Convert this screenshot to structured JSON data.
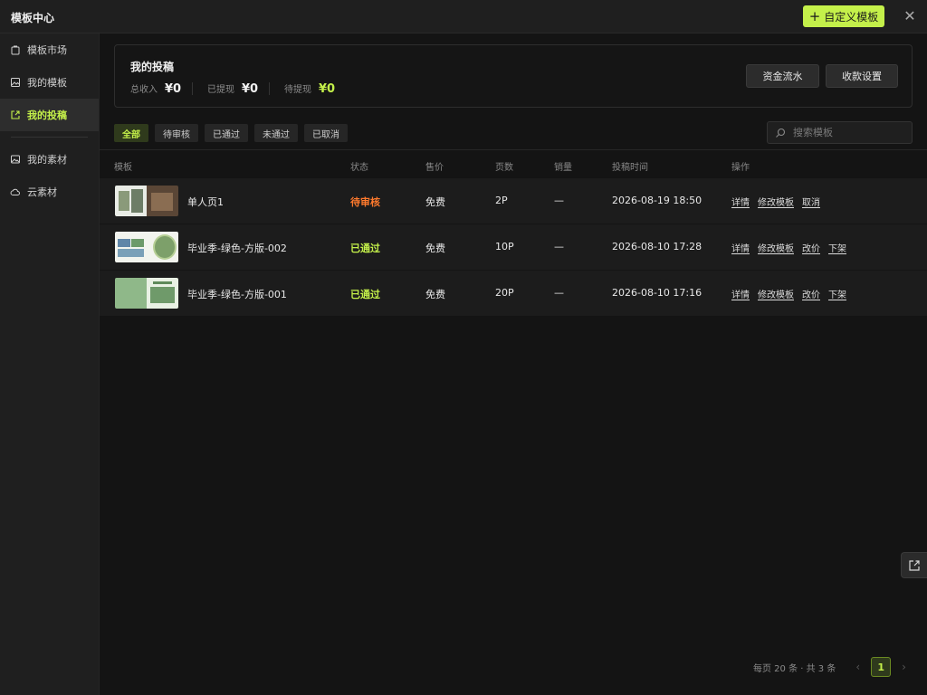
{
  "app": {
    "title": "模板中心",
    "custom_button": "自定义模板"
  },
  "sidebar": {
    "items": [
      {
        "label": "模板市场",
        "icon": "bag-icon",
        "active": false
      },
      {
        "label": "我的模板",
        "icon": "image-book-icon",
        "active": false
      },
      {
        "label": "我的投稿",
        "icon": "share-export-icon",
        "active": true
      },
      {
        "label": "我的素材",
        "icon": "picture-icon",
        "active": false
      },
      {
        "label": "云素材",
        "icon": "cloud-icon",
        "active": false
      }
    ]
  },
  "summary": {
    "title": "我的投稿",
    "total_income_label": "总收入",
    "total_income_value": "¥0",
    "withdrawn_label": "已提现",
    "withdrawn_value": "¥0",
    "pending_label": "待提现",
    "pending_value": "¥0",
    "cashflow_button": "资金流水",
    "payment_settings_button": "收款设置"
  },
  "filters": [
    "全部",
    "待审核",
    "已通过",
    "未通过",
    "已取消"
  ],
  "search": {
    "placeholder": "搜索模板"
  },
  "table": {
    "headers": [
      "模板",
      "状态",
      "售价",
      "页数",
      "销量",
      "投稿时间",
      "操作"
    ],
    "rows": [
      {
        "name": "单人页1",
        "status": "待审核",
        "price": "免费",
        "pages": "2P",
        "sales": "—",
        "time": "2026-08-19 18:50",
        "ops": [
          "详情",
          "修改模板",
          "取消"
        ]
      },
      {
        "name": "毕业季-绿色-方版-002",
        "status": "已通过",
        "price": "免费",
        "pages": "10P",
        "sales": "—",
        "time": "2026-08-10 17:28",
        "ops": [
          "详情",
          "修改模板",
          "改价",
          "下架"
        ]
      },
      {
        "name": "毕业季-绿色-方版-001",
        "status": "已通过",
        "price": "免费",
        "pages": "20P",
        "sales": "—",
        "time": "2026-08-10 17:16",
        "ops": [
          "详情",
          "修改模板",
          "改价",
          "下架"
        ]
      }
    ]
  },
  "pagination": {
    "info": "每页 20 条 · 共 3 条",
    "current_page": "1",
    "prev": "‹",
    "next": "›"
  },
  "colors": {
    "accent": "#c4f04a",
    "pending": "#ff7a2d",
    "background": "#141414",
    "sidebar": "#1f1f1f"
  },
  "window": {
    "close": "✕"
  }
}
